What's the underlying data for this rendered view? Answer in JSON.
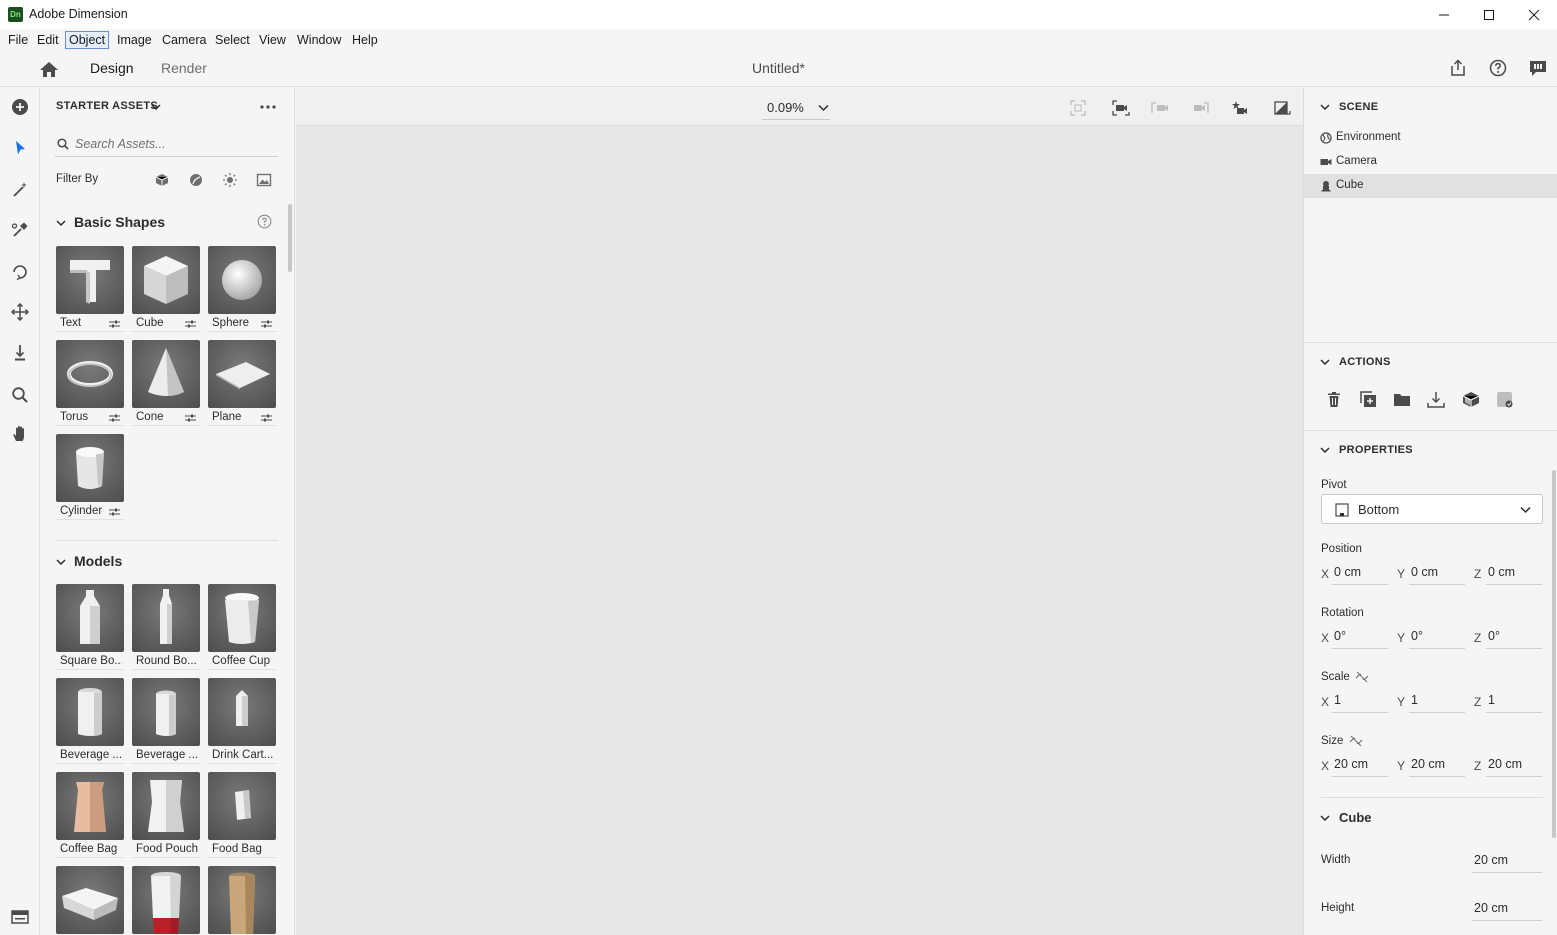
{
  "window": {
    "app_title": "Adobe Dimension",
    "logo_text": "Dn"
  },
  "menu": [
    "File",
    "Edit",
    "Object",
    "Image",
    "Camera",
    "Select",
    "View",
    "Window",
    "Help"
  ],
  "menu_active": "Object",
  "header": {
    "tabs": [
      "Design",
      "Render"
    ],
    "active_tab": "Design",
    "document_title": "Untitled*"
  },
  "assets": {
    "title": "STARTER ASSETS",
    "search_placeholder": "Search Assets...",
    "filter_label": "Filter By",
    "basic_shapes": {
      "title": "Basic Shapes",
      "items": [
        "Text",
        "Cube",
        "Sphere",
        "Torus",
        "Cone",
        "Plane",
        "Cylinder"
      ]
    },
    "models": {
      "title": "Models",
      "items": [
        "Square Bo...",
        "Round Bo...",
        "Coffee Cup",
        "Beverage ...",
        "Beverage ...",
        "Drink Cart...",
        "Coffee Bag",
        "Food Pouch",
        "Food Bag"
      ]
    }
  },
  "viewport": {
    "zoom": "0.09%"
  },
  "scene": {
    "title": "SCENE",
    "items": [
      "Environment",
      "Camera",
      "Cube"
    ],
    "selected": "Cube"
  },
  "actions": {
    "title": "ACTIONS"
  },
  "properties": {
    "title": "PROPERTIES",
    "pivot_label": "Pivot",
    "pivot_value": "Bottom",
    "position": {
      "label": "Position",
      "x": "0 cm",
      "y": "0 cm",
      "z": "0 cm"
    },
    "rotation": {
      "label": "Rotation",
      "x": "0°",
      "y": "0°",
      "z": "0°"
    },
    "scale": {
      "label": "Scale",
      "x": "1",
      "y": "1",
      "z": "1"
    },
    "size": {
      "label": "Size",
      "x": "20 cm",
      "y": "20 cm",
      "z": "20 cm"
    },
    "axis_labels": {
      "x": "X",
      "y": "Y",
      "z": "Z"
    },
    "object": {
      "title": "Cube",
      "width_label": "Width",
      "width_value": "20 cm",
      "height_label": "Height",
      "height_value": "20 cm"
    }
  }
}
